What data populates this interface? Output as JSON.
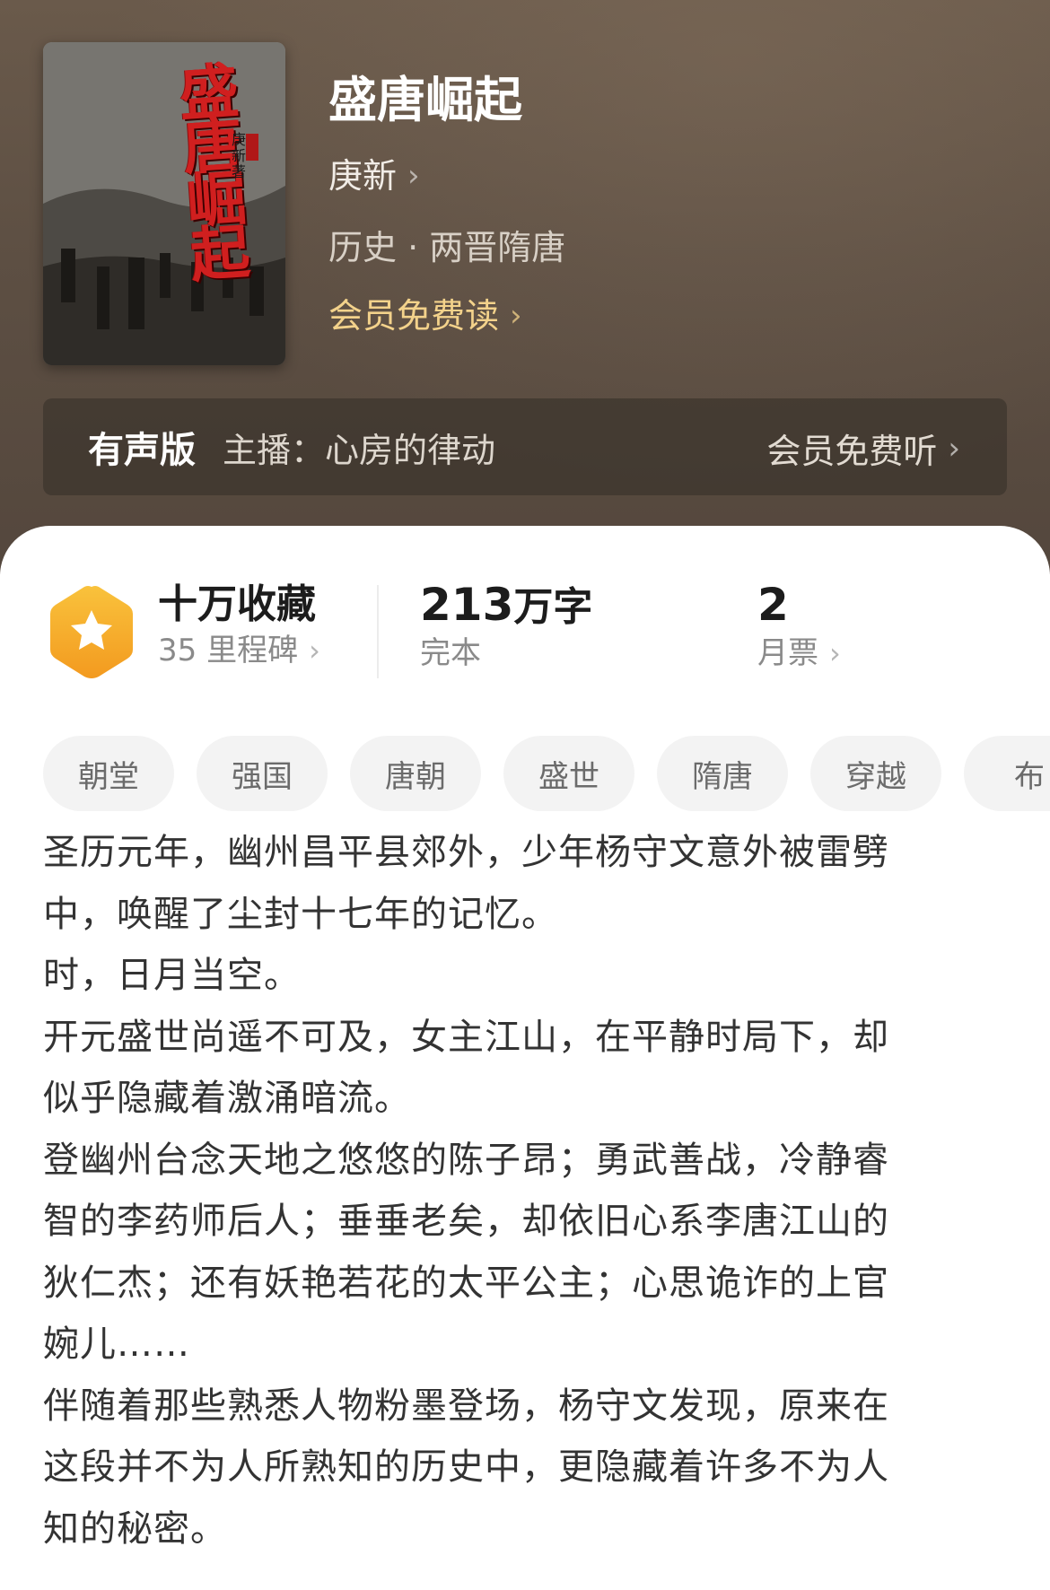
{
  "book": {
    "cover_title": "盛唐崛起",
    "cover_author": "庚新著",
    "title": "盛唐崛起",
    "author": "庚新",
    "category": "历史 · 两晋隋唐",
    "member_read": "会员免费读"
  },
  "audio": {
    "label": "有声版",
    "host": "主播：心房的律动",
    "member_listen": "会员免费听"
  },
  "stats": {
    "favorites": "十万收藏",
    "milestones": "35 里程碑",
    "word_count_number": "213",
    "word_count_unit": "万字",
    "status": "完本",
    "monthly_tickets": "2",
    "monthly_tickets_label": "月票"
  },
  "tags": [
    "朝堂",
    "强国",
    "唐朝",
    "盛世",
    "隋唐",
    "穿越",
    "布"
  ],
  "synopsis": "圣历元年，幽州昌平县郊外，少年杨守文意外被雷劈\n中，唤醒了尘封十七年的记忆。\n时，日月当空。\n开元盛世尚遥不可及，女主江山，在平静时局下，却\n似乎隐藏着激涌暗流。\n登幽州台念天地之悠悠的陈子昂；勇武善战，冷静睿\n智的李药师后人；垂垂老矣，却依旧心系李唐江山的\n狄仁杰；还有妖艳若花的太平公主；心思诡诈的上官\n婉儿……\n伴随着那些熟悉人物粉墨登场，杨守文发现，原来在\n这段并不为人所熟知的历史中，更隐藏着许多不为人\n知的秘密。",
  "colors": {
    "accent_gold": "#f3d28b",
    "badge_orange": "#f6a623"
  }
}
